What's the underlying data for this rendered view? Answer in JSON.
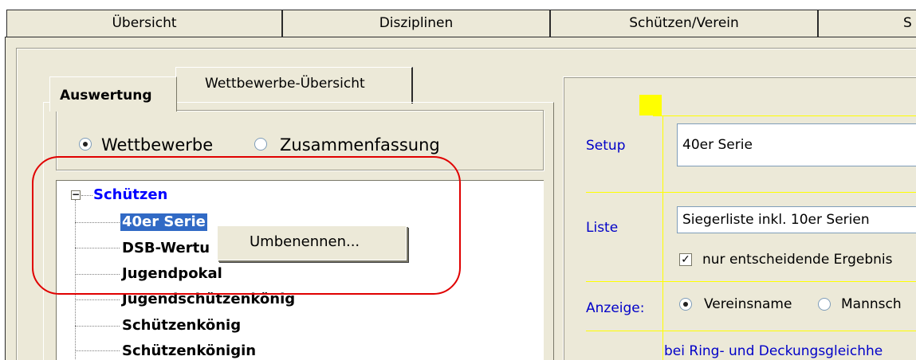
{
  "top_tabs": [
    {
      "label": "Übersicht"
    },
    {
      "label": "Disziplinen"
    },
    {
      "label": "Schützen/Verein"
    },
    {
      "label": "S"
    }
  ],
  "sub_tabs": {
    "active": "Auswertung",
    "other": "Wettbewerbe-Übersicht"
  },
  "radio_group": {
    "option1": "Wettbewerbe",
    "option2": "Zusammenfassung",
    "selected": "Wettbewerbe"
  },
  "tree": {
    "root": "Schützen",
    "children": [
      {
        "label": "40er Serie",
        "selected": true
      },
      {
        "label": "DSB-Wertu"
      },
      {
        "label": "Jugendpokal"
      },
      {
        "label": "Jugendschützenkönig"
      },
      {
        "label": "Schützenkönig"
      },
      {
        "label": "Schützenkönigin"
      }
    ]
  },
  "context_menu": {
    "items": [
      "Umbenennen..."
    ]
  },
  "right_panel": {
    "setup_label": "Setup",
    "setup_value": "40er Serie",
    "liste_label": "Liste",
    "liste_value": "Siegerliste inkl. 10er Serien",
    "checkbox_label": "nur entscheidende Ergebnis",
    "checkbox_checked": true,
    "anzeige_label": "Anzeige:",
    "anzeige_option1": "Vereinsname",
    "anzeige_option2": "Mannsch",
    "bottom_text": "bei Ring- und Deckungsgleichhe"
  },
  "colors": {
    "window_bg": "#ece9d8",
    "annotation": "#e00000",
    "selection": "#316ac5",
    "label_blue": "#0000c8",
    "accent_yellow": "#ffff00"
  }
}
